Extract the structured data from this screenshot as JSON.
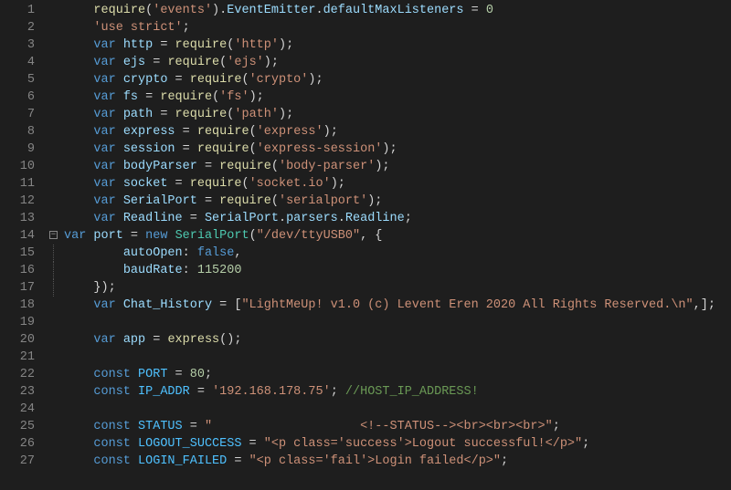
{
  "lines": [
    {
      "n": 1,
      "fold": null,
      "tokens": [
        [
          "text",
          "    "
        ],
        [
          "fn",
          "require"
        ],
        [
          "punc",
          "("
        ],
        [
          "str",
          "'events'"
        ],
        [
          "punc",
          ")."
        ],
        [
          "var",
          "EventEmitter"
        ],
        [
          "punc",
          "."
        ],
        [
          "var",
          "defaultMaxListeners"
        ],
        [
          "text",
          " = "
        ],
        [
          "num",
          "0"
        ]
      ]
    },
    {
      "n": 2,
      "fold": null,
      "tokens": [
        [
          "text",
          "    "
        ],
        [
          "str",
          "'use strict'"
        ],
        [
          "punc",
          ";"
        ]
      ]
    },
    {
      "n": 3,
      "fold": null,
      "tokens": [
        [
          "text",
          "    "
        ],
        [
          "kw",
          "var"
        ],
        [
          "text",
          " "
        ],
        [
          "var",
          "http"
        ],
        [
          "text",
          " = "
        ],
        [
          "fn",
          "require"
        ],
        [
          "punc",
          "("
        ],
        [
          "str",
          "'http'"
        ],
        [
          "punc",
          ");"
        ]
      ]
    },
    {
      "n": 4,
      "fold": null,
      "tokens": [
        [
          "text",
          "    "
        ],
        [
          "kw",
          "var"
        ],
        [
          "text",
          " "
        ],
        [
          "var",
          "ejs"
        ],
        [
          "text",
          " = "
        ],
        [
          "fn",
          "require"
        ],
        [
          "punc",
          "("
        ],
        [
          "str",
          "'ejs'"
        ],
        [
          "punc",
          ");"
        ]
      ]
    },
    {
      "n": 5,
      "fold": null,
      "tokens": [
        [
          "text",
          "    "
        ],
        [
          "kw",
          "var"
        ],
        [
          "text",
          " "
        ],
        [
          "var",
          "crypto"
        ],
        [
          "text",
          " = "
        ],
        [
          "fn",
          "require"
        ],
        [
          "punc",
          "("
        ],
        [
          "str",
          "'crypto'"
        ],
        [
          "punc",
          ");"
        ]
      ]
    },
    {
      "n": 6,
      "fold": null,
      "tokens": [
        [
          "text",
          "    "
        ],
        [
          "kw",
          "var"
        ],
        [
          "text",
          " "
        ],
        [
          "var",
          "fs"
        ],
        [
          "text",
          " = "
        ],
        [
          "fn",
          "require"
        ],
        [
          "punc",
          "("
        ],
        [
          "str",
          "'fs'"
        ],
        [
          "punc",
          ");"
        ]
      ]
    },
    {
      "n": 7,
      "fold": null,
      "tokens": [
        [
          "text",
          "    "
        ],
        [
          "kw",
          "var"
        ],
        [
          "text",
          " "
        ],
        [
          "var",
          "path"
        ],
        [
          "text",
          " = "
        ],
        [
          "fn",
          "require"
        ],
        [
          "punc",
          "("
        ],
        [
          "str",
          "'path'"
        ],
        [
          "punc",
          ");"
        ]
      ]
    },
    {
      "n": 8,
      "fold": null,
      "tokens": [
        [
          "text",
          "    "
        ],
        [
          "kw",
          "var"
        ],
        [
          "text",
          " "
        ],
        [
          "var",
          "express"
        ],
        [
          "text",
          " = "
        ],
        [
          "fn",
          "require"
        ],
        [
          "punc",
          "("
        ],
        [
          "str",
          "'express'"
        ],
        [
          "punc",
          ");"
        ]
      ]
    },
    {
      "n": 9,
      "fold": null,
      "tokens": [
        [
          "text",
          "    "
        ],
        [
          "kw",
          "var"
        ],
        [
          "text",
          " "
        ],
        [
          "var",
          "session"
        ],
        [
          "text",
          " = "
        ],
        [
          "fn",
          "require"
        ],
        [
          "punc",
          "("
        ],
        [
          "str",
          "'express-session'"
        ],
        [
          "punc",
          ");"
        ]
      ]
    },
    {
      "n": 10,
      "fold": null,
      "tokens": [
        [
          "text",
          "    "
        ],
        [
          "kw",
          "var"
        ],
        [
          "text",
          " "
        ],
        [
          "var",
          "bodyParser"
        ],
        [
          "text",
          " = "
        ],
        [
          "fn",
          "require"
        ],
        [
          "punc",
          "("
        ],
        [
          "str",
          "'body-parser'"
        ],
        [
          "punc",
          ");"
        ]
      ]
    },
    {
      "n": 11,
      "fold": null,
      "tokens": [
        [
          "text",
          "    "
        ],
        [
          "kw",
          "var"
        ],
        [
          "text",
          " "
        ],
        [
          "var",
          "socket"
        ],
        [
          "text",
          " = "
        ],
        [
          "fn",
          "require"
        ],
        [
          "punc",
          "("
        ],
        [
          "str",
          "'socket.io'"
        ],
        [
          "punc",
          ");"
        ]
      ]
    },
    {
      "n": 12,
      "fold": null,
      "tokens": [
        [
          "text",
          "    "
        ],
        [
          "kw",
          "var"
        ],
        [
          "text",
          " "
        ],
        [
          "var",
          "SerialPort"
        ],
        [
          "text",
          " = "
        ],
        [
          "fn",
          "require"
        ],
        [
          "punc",
          "("
        ],
        [
          "str",
          "'serialport'"
        ],
        [
          "punc",
          ");"
        ]
      ]
    },
    {
      "n": 13,
      "fold": null,
      "tokens": [
        [
          "text",
          "    "
        ],
        [
          "kw",
          "var"
        ],
        [
          "text",
          " "
        ],
        [
          "var",
          "Readline"
        ],
        [
          "text",
          " = "
        ],
        [
          "var",
          "SerialPort"
        ],
        [
          "punc",
          "."
        ],
        [
          "var",
          "parsers"
        ],
        [
          "punc",
          "."
        ],
        [
          "var",
          "Readline"
        ],
        [
          "punc",
          ";"
        ]
      ]
    },
    {
      "n": 14,
      "fold": "open",
      "tokens": [
        [
          "kw",
          "var"
        ],
        [
          "text",
          " "
        ],
        [
          "var",
          "port"
        ],
        [
          "text",
          " = "
        ],
        [
          "kw",
          "new"
        ],
        [
          "text",
          " "
        ],
        [
          "type",
          "SerialPort"
        ],
        [
          "punc",
          "("
        ],
        [
          "str",
          "\"/dev/ttyUSB0\""
        ],
        [
          "punc",
          ", {"
        ]
      ]
    },
    {
      "n": 15,
      "fold": "line",
      "tokens": [
        [
          "text",
          "        "
        ],
        [
          "var",
          "autoOpen"
        ],
        [
          "punc",
          ":"
        ],
        [
          "text",
          " "
        ],
        [
          "kw",
          "false"
        ],
        [
          "punc",
          ","
        ]
      ]
    },
    {
      "n": 16,
      "fold": "line",
      "tokens": [
        [
          "text",
          "        "
        ],
        [
          "var",
          "baudRate"
        ],
        [
          "punc",
          ":"
        ],
        [
          "text",
          " "
        ],
        [
          "num",
          "115200"
        ]
      ]
    },
    {
      "n": 17,
      "fold": "line",
      "tokens": [
        [
          "text",
          "    "
        ],
        [
          "punc",
          "});"
        ]
      ]
    },
    {
      "n": 18,
      "fold": null,
      "tokens": [
        [
          "text",
          "    "
        ],
        [
          "kw",
          "var"
        ],
        [
          "text",
          " "
        ],
        [
          "var",
          "Chat_History"
        ],
        [
          "text",
          " = ["
        ],
        [
          "str",
          "\"LightMeUp! v1.0 (c) Levent Eren 2020 All Rights Reserved.\\n\""
        ],
        [
          "punc",
          ",];"
        ]
      ]
    },
    {
      "n": 19,
      "fold": null,
      "tokens": []
    },
    {
      "n": 20,
      "fold": null,
      "tokens": [
        [
          "text",
          "    "
        ],
        [
          "kw",
          "var"
        ],
        [
          "text",
          " "
        ],
        [
          "var",
          "app"
        ],
        [
          "text",
          " = "
        ],
        [
          "fn",
          "express"
        ],
        [
          "punc",
          "();"
        ]
      ]
    },
    {
      "n": 21,
      "fold": null,
      "tokens": []
    },
    {
      "n": 22,
      "fold": null,
      "tokens": [
        [
          "text",
          "    "
        ],
        [
          "kw",
          "const"
        ],
        [
          "text",
          " "
        ],
        [
          "const",
          "PORT"
        ],
        [
          "text",
          " = "
        ],
        [
          "num",
          "80"
        ],
        [
          "punc",
          ";"
        ]
      ]
    },
    {
      "n": 23,
      "fold": null,
      "tokens": [
        [
          "text",
          "    "
        ],
        [
          "kw",
          "const"
        ],
        [
          "text",
          " "
        ],
        [
          "const",
          "IP_ADDR"
        ],
        [
          "text",
          " = "
        ],
        [
          "str",
          "'192.168.178.75'"
        ],
        [
          "punc",
          "; "
        ],
        [
          "cmt",
          "//HOST_IP_ADDRESS!"
        ]
      ]
    },
    {
      "n": 24,
      "fold": null,
      "tokens": []
    },
    {
      "n": 25,
      "fold": null,
      "tokens": [
        [
          "text",
          "    "
        ],
        [
          "kw",
          "const"
        ],
        [
          "text",
          " "
        ],
        [
          "const",
          "STATUS"
        ],
        [
          "text",
          " = "
        ],
        [
          "str",
          "\"                    <!--STATUS--><br><br><br>\""
        ],
        [
          "punc",
          ";"
        ]
      ]
    },
    {
      "n": 26,
      "fold": null,
      "tokens": [
        [
          "text",
          "    "
        ],
        [
          "kw",
          "const"
        ],
        [
          "text",
          " "
        ],
        [
          "const",
          "LOGOUT_SUCCESS"
        ],
        [
          "text",
          " = "
        ],
        [
          "str",
          "\"<p class='success'>Logout successful!</p>\""
        ],
        [
          "punc",
          ";"
        ]
      ]
    },
    {
      "n": 27,
      "fold": null,
      "tokens": [
        [
          "text",
          "    "
        ],
        [
          "kw",
          "const"
        ],
        [
          "text",
          " "
        ],
        [
          "const",
          "LOGIN_FAILED"
        ],
        [
          "text",
          " = "
        ],
        [
          "str",
          "\"<p class='fail'>Login failed</p>\""
        ],
        [
          "punc",
          ";"
        ]
      ]
    }
  ]
}
